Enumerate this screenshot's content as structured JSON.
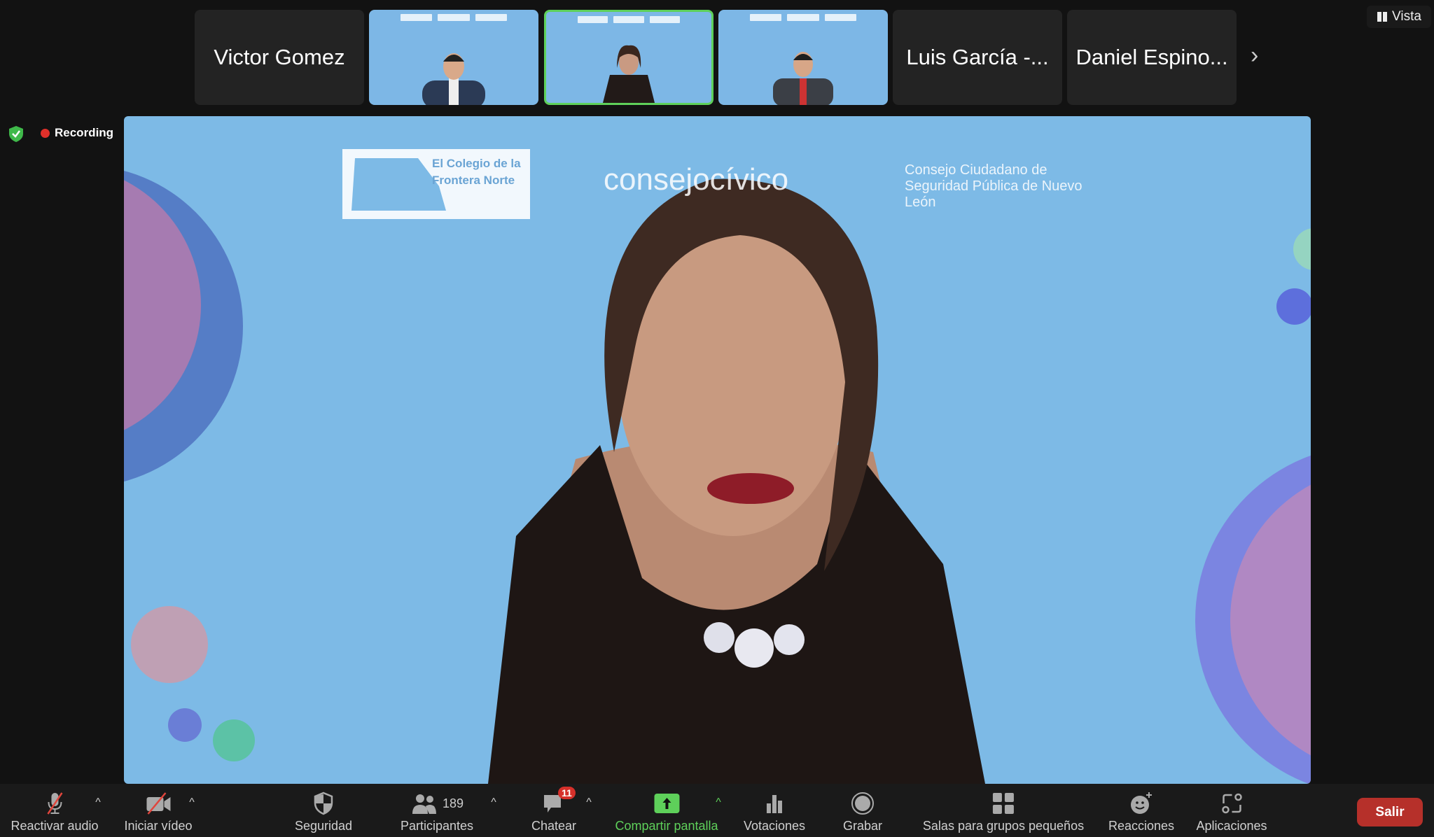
{
  "participants_strip": {
    "tiles": [
      {
        "name": "Victor Gomez",
        "video": false
      },
      {
        "name": "",
        "video": true
      },
      {
        "name": "",
        "video": true,
        "active": true
      },
      {
        "name": "",
        "video": true
      },
      {
        "name": "Luis García -...",
        "video": false
      },
      {
        "name": "Daniel Espino...",
        "video": false
      }
    ],
    "next_icon": "chevron-right"
  },
  "view_button": {
    "label": "Vista",
    "icon": "grid-icon"
  },
  "status": {
    "recording_label": "Recording",
    "security_icon": "shield-check",
    "recording_color": "#e0302a"
  },
  "main_video": {
    "logos": [
      "El Colegio de la Frontera Norte",
      "consejocívico",
      "Consejo Ciudadano de Seguridad Pública de Nuevo León"
    ]
  },
  "toolbar": {
    "audio": "Reactivar audio",
    "video": "Iniciar vídeo",
    "security": "Seguridad",
    "participants": "Participantes",
    "participants_count": "189",
    "chat": "Chatear",
    "chat_badge": "11",
    "share": "Compartir pantalla",
    "polls": "Votaciones",
    "record": "Grabar",
    "breakout": "Salas para grupos pequeños",
    "reactions": "Reacciones",
    "apps": "Aplicaciones",
    "leave": "Salir",
    "caret": "^"
  },
  "colors": {
    "accent_green": "#5ed05a",
    "leave_red": "#b6302a",
    "video_bg": "#7dbae6"
  }
}
